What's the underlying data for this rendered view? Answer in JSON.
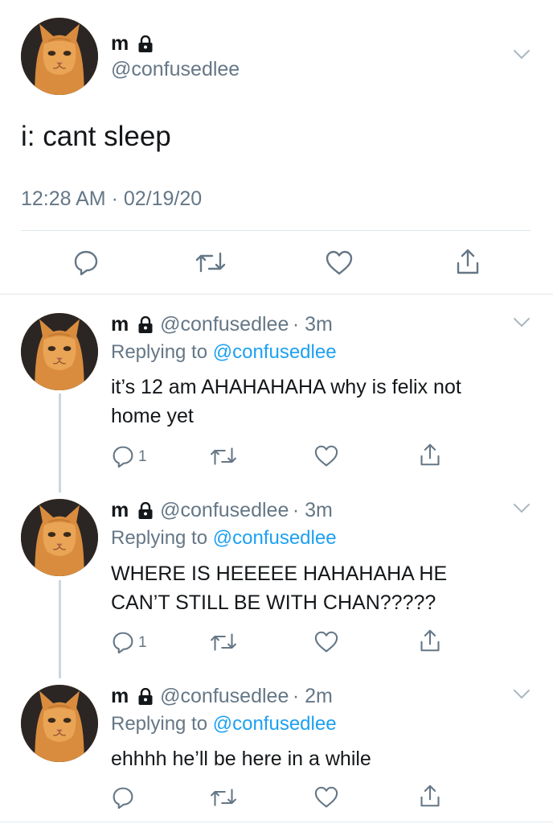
{
  "main_tweet": {
    "name": "m",
    "handle": "@confusedlee",
    "text": "i: cant sleep",
    "timestamp": "12:28 AM · 02/19/20"
  },
  "replies": [
    {
      "name": "m",
      "handle": "@confusedlee",
      "time": "· 3m",
      "replying_prefix": "Replying to",
      "replying_to": "@confusedlee",
      "text_line1": "it’s 12 am AHAHAHAHA why is felix not",
      "text_line2": "home yet",
      "reply_count": "1"
    },
    {
      "name": "m",
      "handle": "@confusedlee",
      "time": "· 3m",
      "replying_prefix": "Replying to",
      "replying_to": "@confusedlee",
      "text_line1": "WHERE IS HEEEEE HAHAHAHA HE",
      "text_line2": "CAN’T STILL BE WITH CHAN?????",
      "reply_count": "1"
    },
    {
      "name": "m",
      "handle": "@confusedlee",
      "time": "· 2m",
      "replying_prefix": "Replying to",
      "replying_to": "@confusedlee",
      "text_line1": "ehhhh he’ll be here in a while",
      "reply_count": ""
    }
  ],
  "icons": [
    "lock-icon",
    "chevron-down-icon",
    "reply-icon",
    "retweet-icon",
    "like-icon",
    "share-icon"
  ],
  "colors": {
    "link": "#1da1f2",
    "secondary": "#657786",
    "text": "#14171a",
    "divider": "#e1e8ed"
  }
}
